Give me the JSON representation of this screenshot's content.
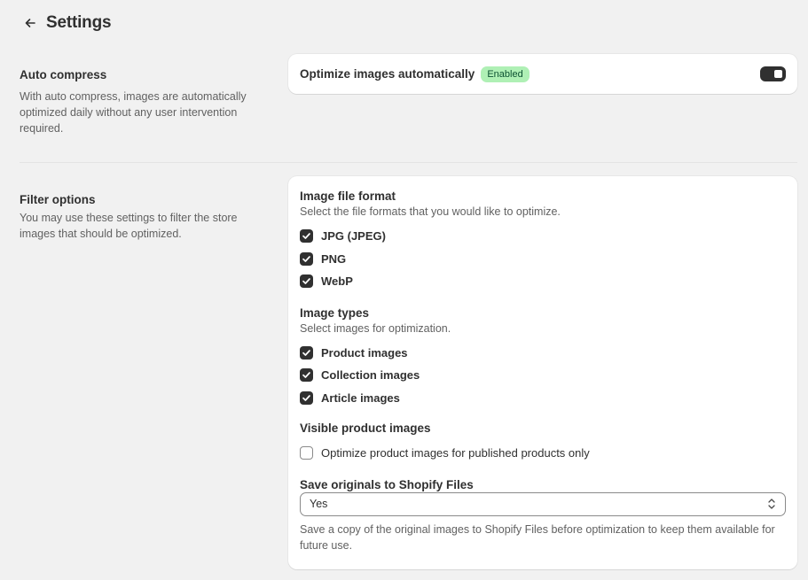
{
  "header": {
    "title": "Settings",
    "back_icon": "arrow-left-icon"
  },
  "auto_compress": {
    "title": "Auto compress",
    "description": "With auto compress, images are automatically optimized daily without any user intervention required.",
    "setting_label": "Optimize images automatically",
    "badge": "Enabled",
    "enabled": true
  },
  "filter_options": {
    "title": "Filter options",
    "description": "You may use these settings to filter the store images that should be optimized.",
    "file_format": {
      "title": "Image file format",
      "description": "Select the file formats that you would like to optimize.",
      "options": [
        {
          "label": "JPG (JPEG)",
          "checked": true
        },
        {
          "label": "PNG",
          "checked": true
        },
        {
          "label": "WebP",
          "checked": true
        }
      ]
    },
    "image_types": {
      "title": "Image types",
      "description": "Select images for optimization.",
      "options": [
        {
          "label": "Product images",
          "checked": true
        },
        {
          "label": "Collection images",
          "checked": true
        },
        {
          "label": "Article images",
          "checked": true
        }
      ]
    },
    "visible_products": {
      "title": "Visible product images",
      "option": {
        "label": "Optimize product images for published products only",
        "checked": false
      }
    },
    "save_originals": {
      "title": "Save originals to Shopify Files",
      "selected": "Yes",
      "help": "Save a copy of the original images to Shopify Files before optimization to keep them available for future use."
    }
  },
  "colors": {
    "badge_bg": "#aff0b5",
    "badge_text": "#0c5132",
    "toggle_on": "#303030",
    "page_bg": "#f1f1f1"
  }
}
